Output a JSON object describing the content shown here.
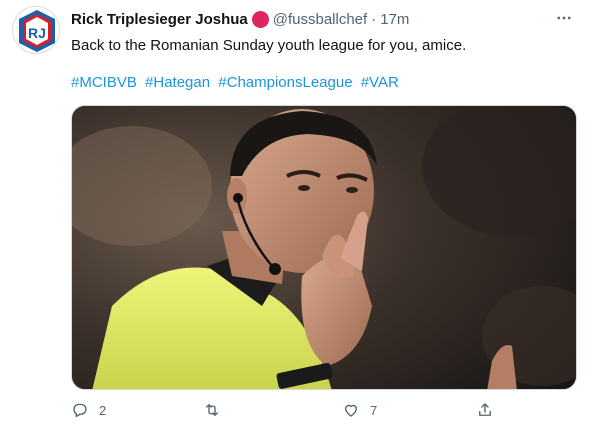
{
  "tweet": {
    "display_name": "Rick Triplesieger Joshua",
    "handle": "@fussballchef",
    "separator": "·",
    "time": "17m",
    "avatar_initials": "RJ",
    "text": "Back to the Romanian Sunday youth league for you, amice.",
    "hashtags": [
      "#MCIBVB",
      "#Hategan",
      "#ChampionsLeague",
      "#VAR"
    ],
    "media": {
      "subject": "referee-photo"
    },
    "actions": {
      "reply_count": "2",
      "retweet_count": "",
      "like_count": "7",
      "share_count": ""
    }
  },
  "colors": {
    "link": "#1b95e0",
    "secondary_text": "#536471",
    "badge": "#e0245e",
    "avatar_blue": "#1d5fa8",
    "avatar_red": "#d42027",
    "jersey_yellow": "#e9f06a"
  },
  "icons": [
    "avatar-logo",
    "verified-badge",
    "more-options-icon",
    "reply-icon",
    "retweet-icon",
    "like-icon",
    "share-icon"
  ]
}
